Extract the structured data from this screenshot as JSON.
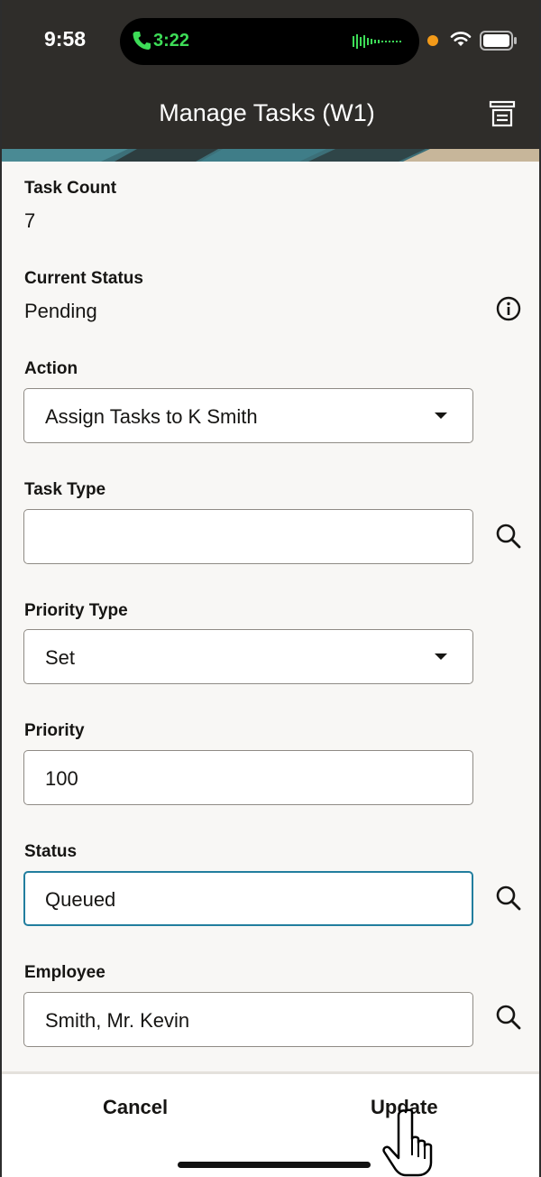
{
  "status_bar": {
    "time": "9:58",
    "call_time": "3:22"
  },
  "header": {
    "title": "Manage Tasks (W1)"
  },
  "fields": {
    "task_count": {
      "label": "Task Count",
      "value": "7"
    },
    "current_status": {
      "label": "Current Status",
      "value": "Pending"
    },
    "action": {
      "label": "Action",
      "value": "Assign Tasks to K Smith"
    },
    "task_type": {
      "label": "Task Type",
      "value": ""
    },
    "priority_type": {
      "label": "Priority Type",
      "value": "Set"
    },
    "priority": {
      "label": "Priority",
      "value": "100"
    },
    "status": {
      "label": "Status",
      "value": "Queued"
    },
    "employee": {
      "label": "Employee",
      "value": "Smith, Mr. Kevin"
    }
  },
  "footer": {
    "cancel_label": "Cancel",
    "update_label": "Update"
  },
  "icons": {
    "call": "phone-icon",
    "wifi": "wifi-icon",
    "battery": "battery-icon",
    "menu": "overflow-menu-icon",
    "info": "info-icon",
    "search": "search-icon",
    "dropdown": "chevron-down-icon",
    "cursor": "hand-pointer-icon"
  },
  "colors": {
    "header_bg": "#2f2d2a",
    "call_green": "#3ddc57",
    "mic_dot": "#f39a19",
    "focus_border": "#227e9e",
    "page_bg": "#f8f7f5"
  }
}
